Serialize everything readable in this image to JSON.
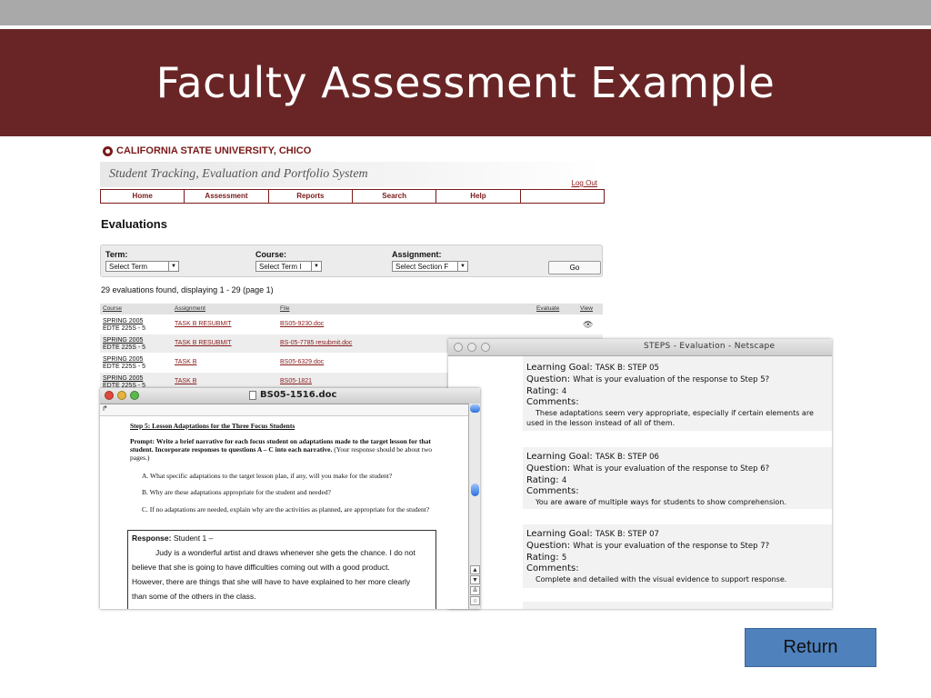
{
  "slide": {
    "title": "Faculty Assessment Example",
    "return_label": "Return"
  },
  "browser": {
    "university": "CALIFORNIA STATE UNIVERSITY, CHICO",
    "system_title": "Student Tracking, Evaluation and Portfolio System",
    "logout": "Log Out",
    "nav": [
      "Home",
      "Assessment",
      "Reports",
      "Search",
      "Help",
      ""
    ],
    "heading": "Evaluations",
    "filters": {
      "term_label": "Term:",
      "term_value": "Select Term",
      "course_label": "Course:",
      "course_value": "Select Term I",
      "assignment_label": "Assignment:",
      "assignment_value": "Select Section F",
      "go": "Go"
    },
    "count_text": "29 evaluations found, displaying 1 - 29 (page 1)",
    "table": {
      "headers": {
        "course": "Course",
        "assignment": "Assignment",
        "file": "File",
        "evaluate": "Evaluate",
        "view": "View"
      },
      "rows": [
        {
          "course1": "SPRING 2005",
          "course2": "EDTE 225S - 5",
          "assignment": "TASK B RESUBMIT",
          "file": "BS05-9230.doc",
          "view": "👁"
        },
        {
          "course1": "SPRING 2005",
          "course2": "EDTE 225S - 5",
          "assignment": "TASK B RESUBMIT",
          "file": "BS-05-7785 resubmit.doc",
          "view": ""
        },
        {
          "course1": "SPRING 2005",
          "course2": "EDTE 225S - 5",
          "assignment": "TASK B",
          "file": "BS05-6329.doc",
          "view": ""
        },
        {
          "course1": "SPRING 2005",
          "course2": "EDTE 225S - 5",
          "assignment": "TASK B",
          "file": "BS05-1821",
          "view": ""
        }
      ]
    }
  },
  "eval_window": {
    "title": "STEPS - Evaluation - Netscape",
    "labels": {
      "goal": "Learning Goal:",
      "question": "Question:",
      "rating": "Rating:",
      "comments": "Comments:"
    },
    "entries": [
      {
        "goal": "TASK B: STEP 05",
        "question": "What is your evaluation of the response to Step 5?",
        "rating": "4",
        "comment": "These adaptations seem very appropriate, especially if certain elements are used in the lesson instead of all of them."
      },
      {
        "goal": "TASK B: STEP 06",
        "question": "What is your evaluation of the response to Step 6?",
        "rating": "4",
        "comment": "You are aware of multiple ways for students to show comprehension."
      },
      {
        "goal": "TASK B: STEP 07",
        "question": "What is your evaluation of the response to Step 7?",
        "rating": "5",
        "comment": "Complete and detailed with the visual evidence to support response."
      }
    ]
  },
  "doc_window": {
    "title": "BS05-1516.doc",
    "step_heading": "Step 5: Lesson Adaptations for the Three Focus Students",
    "prompt_label": "Prompt:",
    "prompt_bold": "Write a brief narrative for each focus student on adaptations made to the target lesson for that student. Incorporate responses to questions A – C into each narrative.",
    "prompt_rest": "(Your response should be about two pages.)",
    "questions": [
      "A.   What specific adaptations to the target lesson plan, if any, will you make for the student?",
      "B.   Why are these adaptations appropriate for the student and needed?",
      "C.   If no adaptations are needed, explain why are the activities as planned, are appropriate for the student?"
    ],
    "response_label": "Response:",
    "response_student": "Student 1 –",
    "response_lines": [
      "Judy is a wonderful artist and draws whenever she gets the chance.  I do not",
      "believe that she is going to have difficulties coming out with a good product.",
      "However, there are things that she will have to have explained to her more clearly",
      "than some of the others in the class."
    ]
  },
  "colors": {
    "title_bar": "#692525",
    "top_bar": "#a9a9a9",
    "csu_red": "#7a1a1a",
    "return_button": "#4f81bd"
  }
}
